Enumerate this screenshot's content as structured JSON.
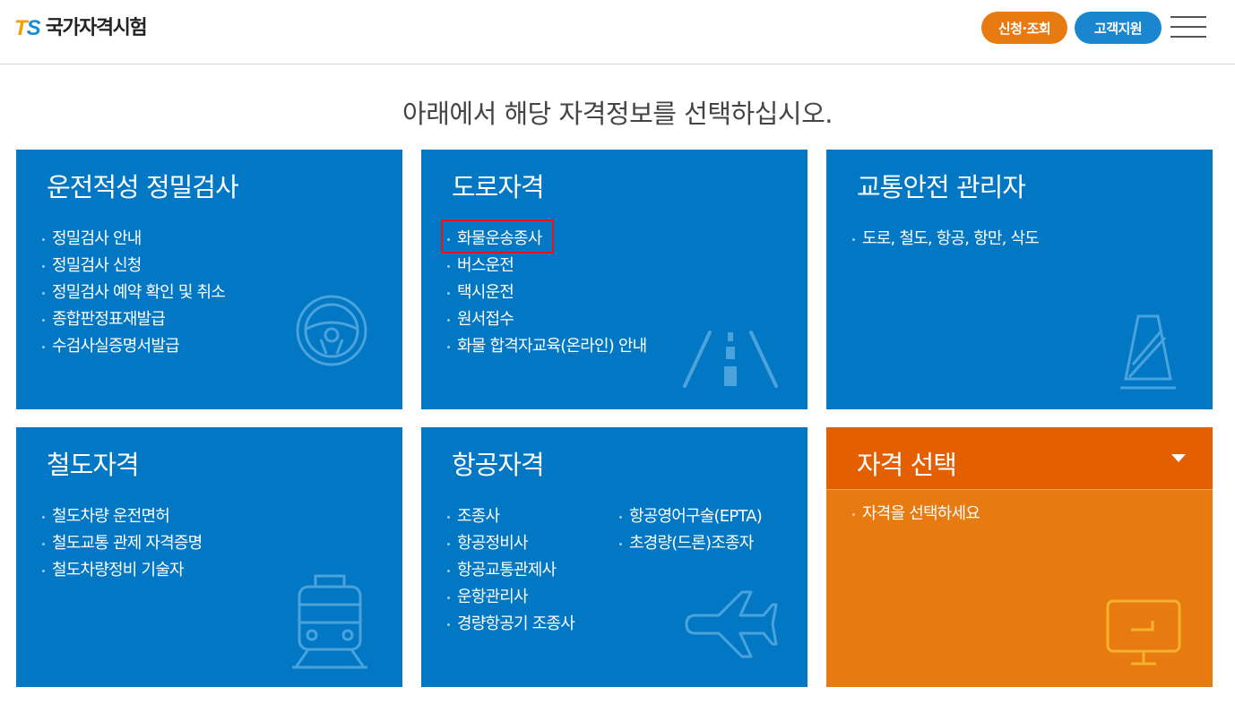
{
  "header": {
    "logo_mark_t": "T",
    "logo_mark_s": "S",
    "logo_text": "국가자격시험",
    "apply_label": "신청·조회",
    "support_label": "고객지원",
    "menu_icon": "hamburger-menu-icon"
  },
  "headline": "아래에서 해당 자격정보를 선택하십시오.",
  "colors": {
    "card_blue": "#0277c4",
    "card_orange": "#e87a12",
    "select_head": "#e35f00",
    "btn_orange": "#e87a12",
    "btn_blue": "#1a86cf",
    "highlight_red": "#e8131b"
  },
  "cards": [
    {
      "title": "운전적성 정밀검사",
      "icon": "steering-wheel-icon",
      "items": [
        "정밀검사 안내",
        "정밀검사 신청",
        "정밀검사 예약 확인 및 취소",
        "종합판정표재발급",
        "수검사실증명서발급"
      ]
    },
    {
      "title": "도로자격",
      "icon": "road-icon",
      "items": [
        "화물운송종사",
        "버스운전",
        "택시운전",
        "원서접수",
        "화물 합격자교육(온라인) 안내"
      ],
      "highlighted_item": "화물운송종사"
    },
    {
      "title": "교통안전 관리자",
      "icon": "traffic-cone-icon",
      "items": [
        "도로, 철도, 항공, 항만, 삭도"
      ]
    },
    {
      "title": "철도자격",
      "icon": "train-icon",
      "items": [
        "철도차량 운전면허",
        "철도교통 관제 자격증명",
        "철도차량정비 기술자"
      ]
    },
    {
      "title": "항공자격",
      "icon": "airplane-icon",
      "items_col1": [
        "조종사",
        "항공정비사",
        "항공교통관제사",
        "운항관리사",
        "경량항공기 조종사"
      ],
      "items_col2": [
        "항공영어구술(EPTA)",
        "초경량(드론)조종자"
      ]
    },
    {
      "title": "자격 선택",
      "icon": "monitor-arrow-icon",
      "caret_icon": "caret-down-icon",
      "items": [
        "자격을 선택하세요"
      ]
    }
  ]
}
